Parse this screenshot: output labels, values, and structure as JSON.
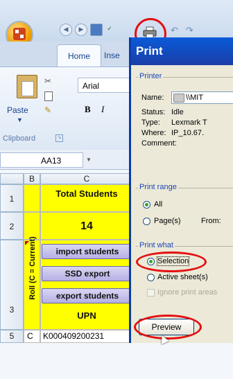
{
  "ribbon": {
    "tab_home": "Home",
    "tab_insert": "Inse",
    "paste_label": "Paste",
    "clipboard_label": "Clipboard",
    "font_name": "Arial",
    "bold": "B",
    "italic": "I"
  },
  "namebox": {
    "value": "AA13"
  },
  "columns": {
    "b": "B",
    "c": "C"
  },
  "rows": {
    "r1": "1",
    "r2": "2",
    "r3": "3",
    "r5": "5"
  },
  "sheet": {
    "total_students_label": "Total Students",
    "total_students_value": "14",
    "import_btn": "import students",
    "ssd_btn": "SSD export",
    "export_btn": "export students",
    "roll_label": "Roll (C = Current)",
    "upn_header": "UPN",
    "row5_b": "C",
    "row5_c": "K000409200231"
  },
  "dialog": {
    "title": "Print",
    "printer_group": "Printer",
    "name_label": "Name:",
    "name_value": "\\\\MIT",
    "status_label": "Status:",
    "status_value": "Idle",
    "type_label": "Type:",
    "type_value": "Lexmark T",
    "where_label": "Where:",
    "where_value": "IP_10.67.",
    "comment_label": "Comment:",
    "range_group": "Print range",
    "all_option": "All",
    "pages_option": "Page(s)",
    "from_label": "From:",
    "what_group": "Print what",
    "selection_option": "Selection",
    "active_option": "Active sheet(s)",
    "ignore_option": "Ignore print areas",
    "preview_btn": "Preview"
  },
  "colors": {
    "highlight_ring": "#e31010",
    "cell_yellow": "#ffff00",
    "button_purple": "#b6b0e4",
    "title_bar": "#0a5ad8"
  }
}
